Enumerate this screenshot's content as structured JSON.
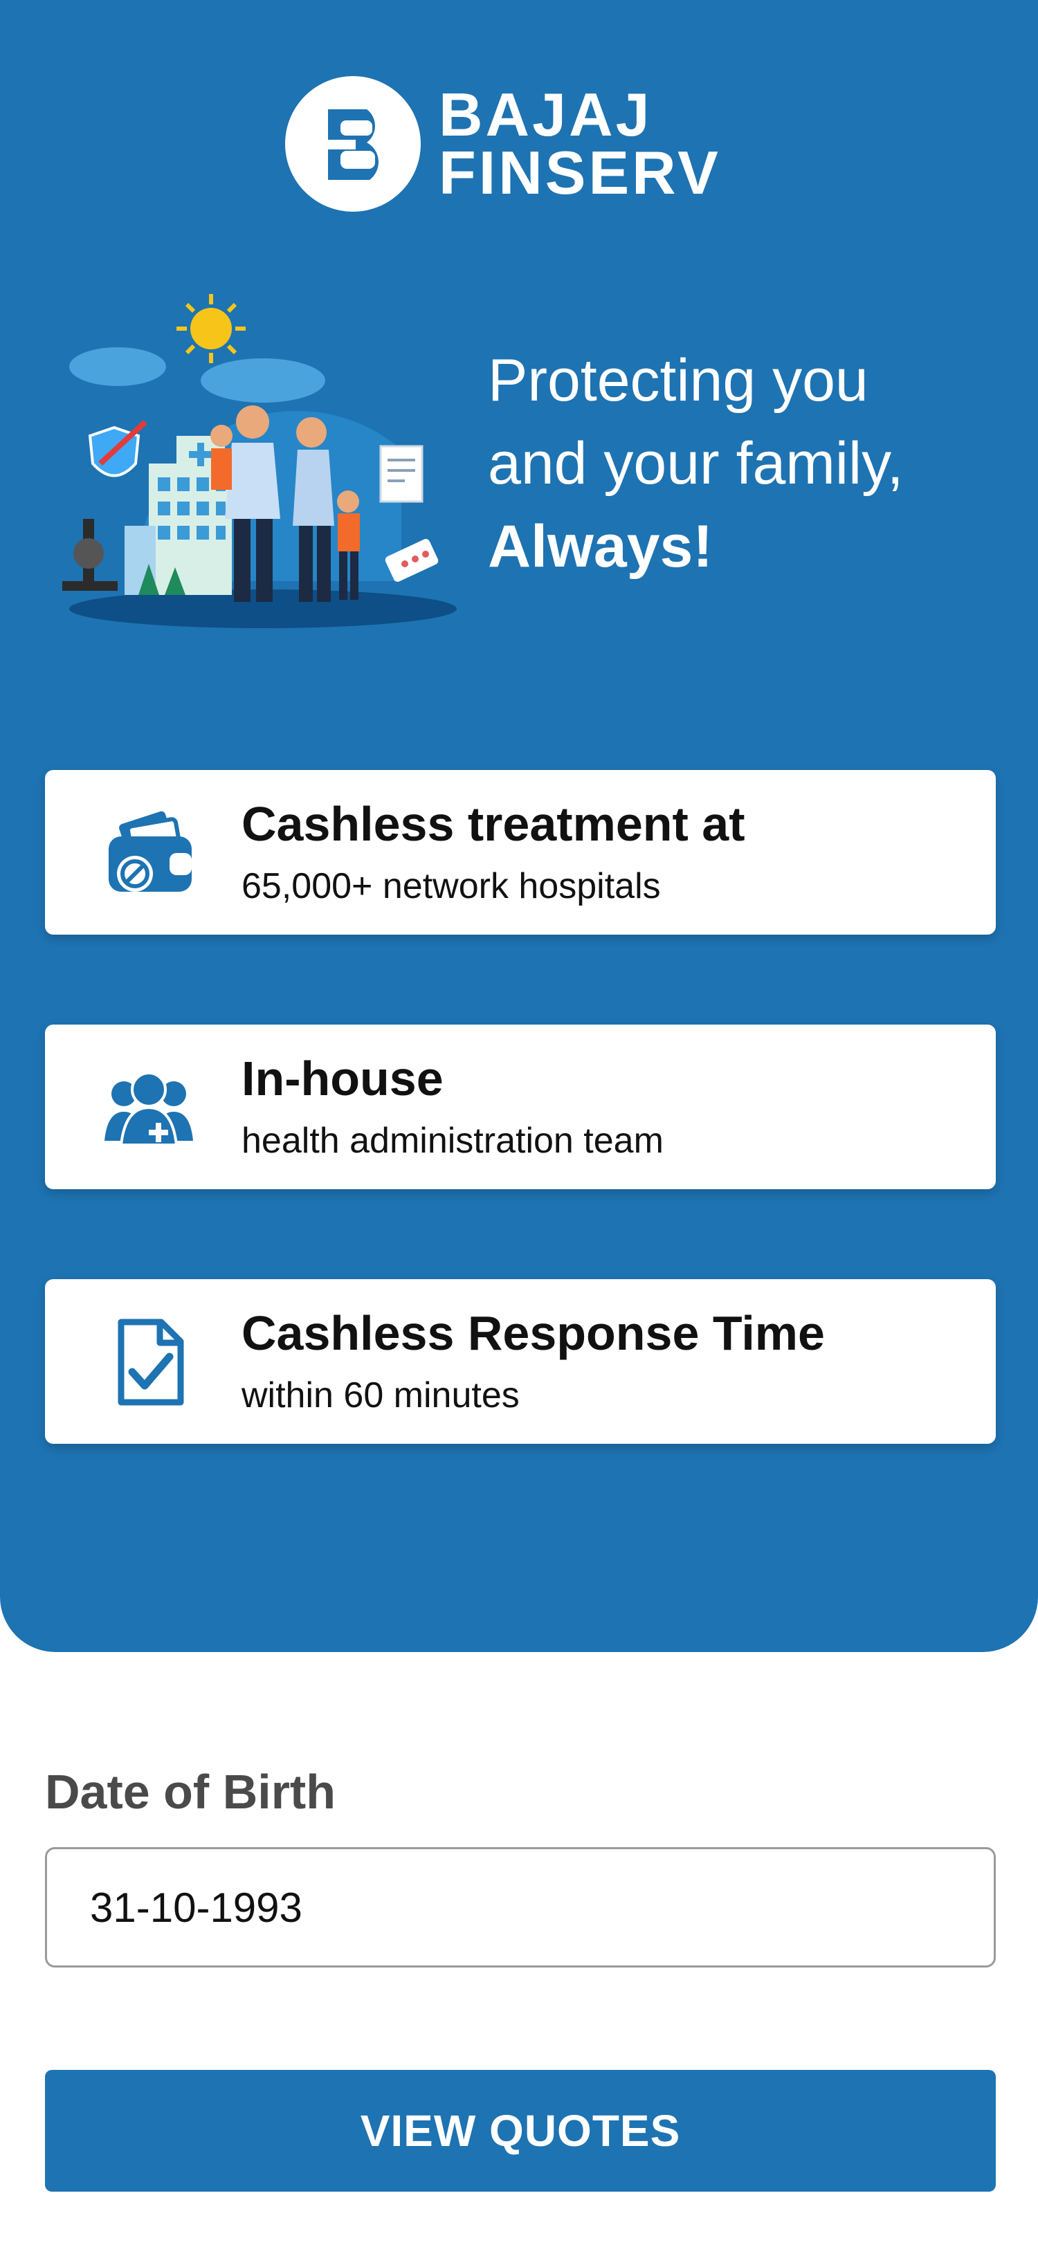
{
  "brand": {
    "name_line1": "BAJAJ",
    "name_line2": "FINSERV",
    "color": "#1e73b2"
  },
  "hero": {
    "tagline_line1": "Protecting you",
    "tagline_line2": "and your family,",
    "tagline_line3": "Always!"
  },
  "features": [
    {
      "icon": "wallet-icon",
      "title": "Cashless treatment at",
      "subtitle": "65,000+ network hospitals"
    },
    {
      "icon": "medical-team-icon",
      "title": "In-house",
      "subtitle": "health administration team"
    },
    {
      "icon": "document-check-icon",
      "title": "Cashless Response Time",
      "subtitle": "within 60 minutes"
    }
  ],
  "form": {
    "dob_label": "Date of Birth",
    "dob_value": "31-10-1993",
    "submit_label": "VIEW QUOTES"
  }
}
